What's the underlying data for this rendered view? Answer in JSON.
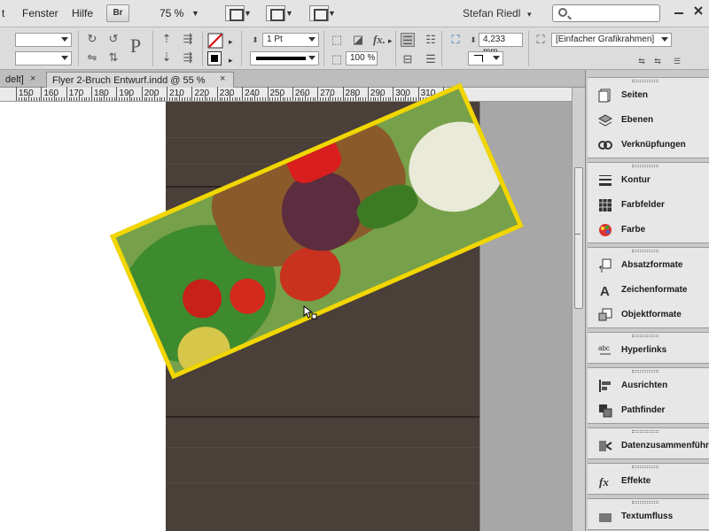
{
  "menubar": {
    "items": [
      {
        "label": "t"
      },
      {
        "label": "Fenster"
      },
      {
        "label": "Hilfe"
      }
    ],
    "bridge_label": "Br",
    "zoom": "75 %",
    "user": "Stefan Riedl",
    "search_placeholder": ""
  },
  "control": {
    "stroke_weight": "1 Pt",
    "scale": "100 %",
    "width_value": "4,233 mm",
    "frame_style": "[Einfacher Grafikrahmen]",
    "text_p": "P",
    "fx_label": "fx."
  },
  "tabs": [
    {
      "label": "delt]",
      "active": false
    },
    {
      "label": "Flyer 2-Bruch Entwurf.indd @ 55 %",
      "active": true
    }
  ],
  "ruler": {
    "labels": [
      "150",
      "160",
      "170",
      "180",
      "190",
      "200",
      "210",
      "220",
      "230",
      "240",
      "250",
      "260",
      "270",
      "280",
      "290",
      "300",
      "310",
      "320"
    ]
  },
  "panels": {
    "groups": [
      {
        "items": [
          {
            "label": "Seiten",
            "icon": "pages-icon"
          },
          {
            "label": "Ebenen",
            "icon": "layers-icon"
          },
          {
            "label": "Verknüpfungen",
            "icon": "links-icon"
          }
        ]
      },
      {
        "items": [
          {
            "label": "Kontur",
            "icon": "stroke-icon"
          },
          {
            "label": "Farbfelder",
            "icon": "swatches-icon"
          },
          {
            "label": "Farbe",
            "icon": "color-icon"
          }
        ]
      },
      {
        "items": [
          {
            "label": "Absatzformate",
            "icon": "paragraph-styles-icon"
          },
          {
            "label": "Zeichenformate",
            "icon": "character-styles-icon"
          },
          {
            "label": "Objektformate",
            "icon": "object-styles-icon"
          }
        ]
      },
      {
        "items": [
          {
            "label": "Hyperlinks",
            "icon": "hyperlinks-icon"
          }
        ]
      },
      {
        "items": [
          {
            "label": "Ausrichten",
            "icon": "align-icon"
          },
          {
            "label": "Pathfinder",
            "icon": "pathfinder-icon"
          }
        ]
      },
      {
        "items": [
          {
            "label": "Datenzusammenführ",
            "icon": "data-merge-icon"
          }
        ]
      },
      {
        "items": [
          {
            "label": "Effekte",
            "icon": "effects-icon"
          }
        ]
      },
      {
        "items": [
          {
            "label": "Textumfluss",
            "icon": "text-wrap-icon"
          }
        ]
      }
    ]
  },
  "colors": {
    "frame_stroke": "#f2d600",
    "wood": "#4a3f39",
    "pasteboard": "#ffffff"
  }
}
